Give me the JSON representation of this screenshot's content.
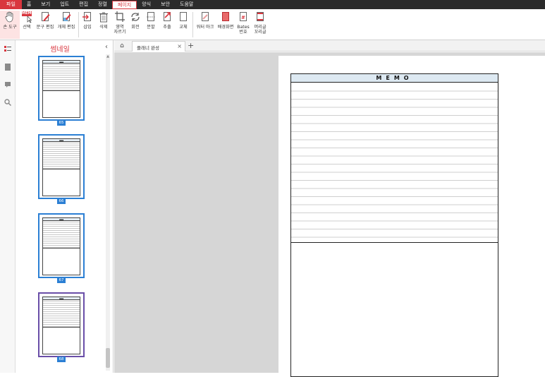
{
  "menu": [
    "파일",
    "홈",
    "보기",
    "업트",
    "편집",
    "정렬",
    "페이지",
    "양식",
    "보안",
    "도움말"
  ],
  "menu_active": "페이지",
  "ribbon": {
    "hand_tool": "손 도구",
    "select": "선택",
    "text_edit": "문구 편집",
    "object_edit": "개체 편집",
    "insert": "삽입",
    "delete": "삭제",
    "crop_l1": "영역",
    "crop_l2": "자르기",
    "rotate": "회전",
    "extract": "분할",
    "export": "추출",
    "replace": "교체",
    "watermark": "워터 마크",
    "background": "배경화면",
    "bates_l1": "Bates",
    "bates_l2": "번호",
    "header_footer_l1": "머리글",
    "header_footer_l2": "꼬리글",
    "memo_badge": "MEMO"
  },
  "thumbnails": {
    "title": "썸네일",
    "pages": [
      "65",
      "66",
      "67",
      "68"
    ]
  },
  "tabs": {
    "document": "플래너 완성"
  },
  "page": {
    "memo_heading": "MEMO"
  },
  "colors": {
    "accent": "#d9363e",
    "selection": "#2b7fd4",
    "memo_header_bg": "#dde9f2"
  }
}
